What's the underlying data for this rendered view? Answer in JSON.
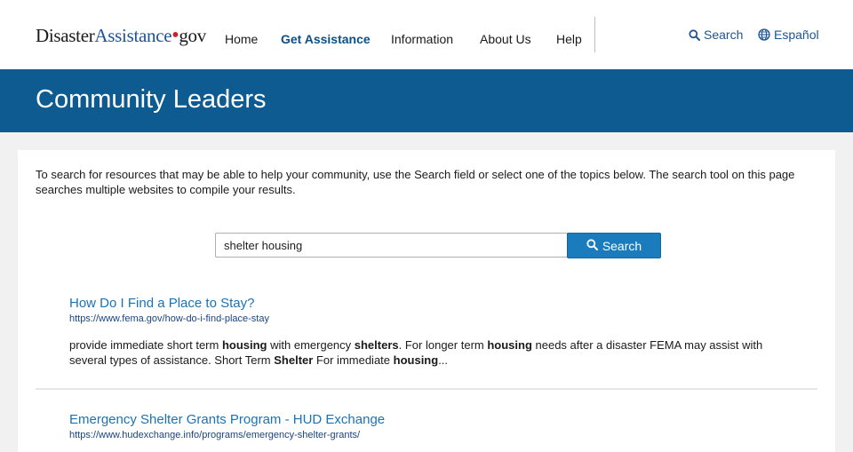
{
  "header": {
    "logo": {
      "part1": "Disaster",
      "part2": "Assistance",
      "dot": "•",
      "part3": "gov"
    },
    "nav": [
      {
        "label": "Home"
      },
      {
        "label": "Get Assistance"
      },
      {
        "label": "Information"
      },
      {
        "label": "About Us"
      },
      {
        "label": "Help"
      }
    ],
    "search_link": "Search",
    "language_link": "Español"
  },
  "banner": {
    "title": "Community Leaders"
  },
  "main": {
    "intro": "To search for resources that may be able to help your community, use the Search field or select one of the topics below. The search tool on this page searches multiple websites to compile your results.",
    "search": {
      "value": "shelter housing",
      "button_label": "Search"
    },
    "results": [
      {
        "title": "How Do I Find a Place to Stay?",
        "url": "https://www.fema.gov/how-do-i-find-place-stay",
        "snippet": {
          "s1": "provide immediate short term ",
          "b1": "housing",
          "s2": " with emergency ",
          "b2": "shelters",
          "s3": ".  For longer term ",
          "b3": "housing",
          "s4": " needs after a disaster FEMA may assist with several types of assistance. Short Term ",
          "b4": "Shelter",
          "s5": " For immediate ",
          "b5": "housing",
          "s6": "..."
        }
      },
      {
        "title": "Emergency Shelter Grants Program - HUD Exchange",
        "url": "https://www.hudexchange.info/programs/emergency-shelter-grants/"
      }
    ]
  },
  "colors": {
    "banner": "#0d5b91",
    "link": "#1a73b5",
    "button": "#1a7bbd",
    "logo_dot": "#cd2026"
  }
}
